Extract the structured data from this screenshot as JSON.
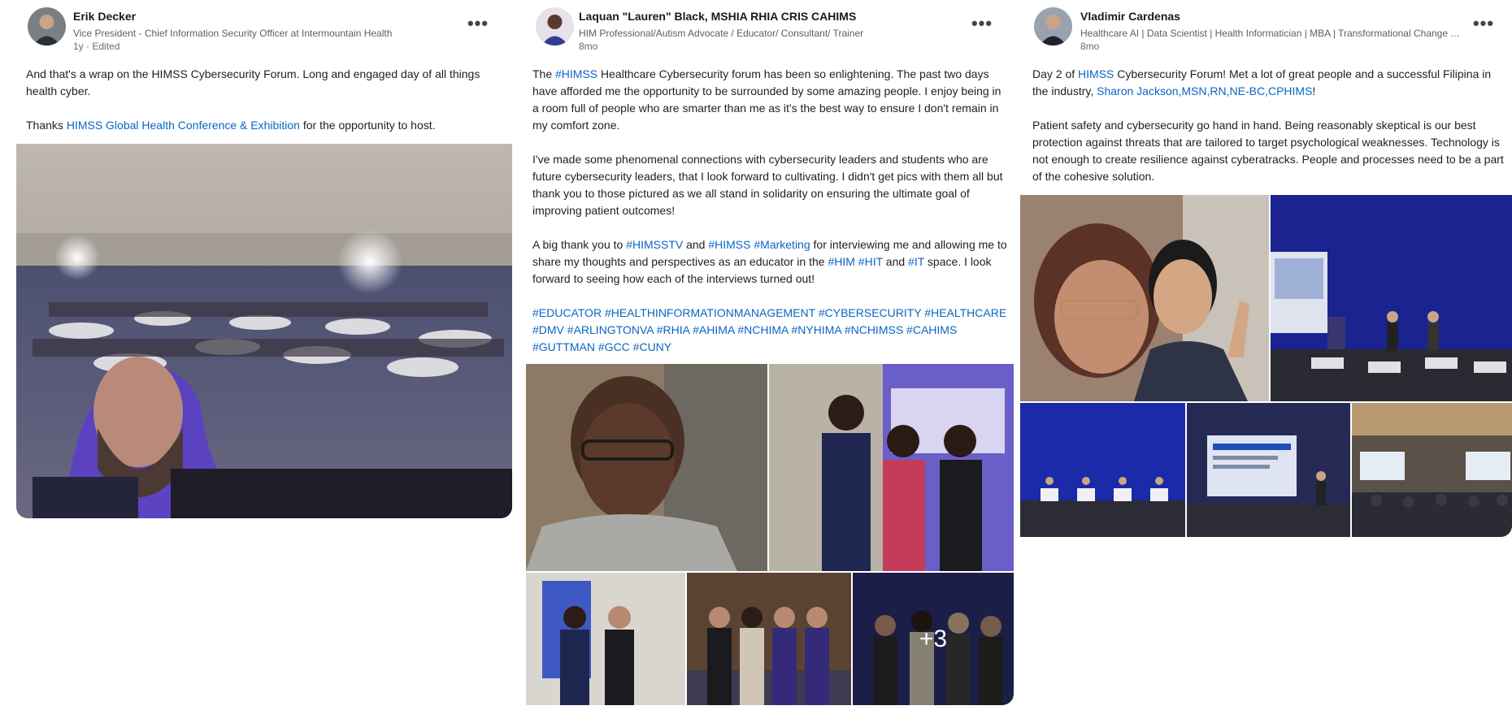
{
  "posts": [
    {
      "author": "Erik Decker",
      "headline": "Vice President - Chief Information Security Officer at Intermountain Health",
      "time": "1y",
      "edited": "Edited",
      "more_label": "•••",
      "text1": "And that's a wrap on the HIMSS Cybersecurity Forum. Long and engaged day of all things health cyber.",
      "text2_pre": "Thanks ",
      "text2_link": "HIMSS Global Health Conference & Exhibition",
      "text2_post": "  for the opportunity to host.",
      "image_icon": "conference-hall-selfie-photo"
    },
    {
      "author": "Laquan \"Lauren\" Black, MSHIA RHIA CRIS CAHIMS",
      "headline": "HIM Professional/Autism Advocate / Educator/ Consultant/ Trainer",
      "time": "8mo",
      "more_label": "•••",
      "para1_pre": "The ",
      "para1_tag": "#HIMSS",
      "para1_post": " Healthcare Cybersecurity forum has been so enlightening. The past two days have afforded me the opportunity to be surrounded by some amazing people. I enjoy being in a room full of people who are smarter than me as it's the best way to ensure I don't remain in my comfort zone.",
      "para2": "I've made some phenomenal connections with cybersecurity leaders and students who are future cybersecurity leaders, that I look forward to cultivating. I didn't get pics with them all but thank you to those pictured as we all stand in solidarity on ensuring the ultimate goal of improving patient outcomes!",
      "para3_a": "A big thank you to ",
      "para3_tag1": "#HIMSSTV",
      "para3_b": " and ",
      "para3_tag2": "#HIMSS #Marketing",
      "para3_c": " for interviewing me and allowing me to share my thoughts and perspectives as an educator in the ",
      "para3_tag3": "#HIM #HIT",
      "para3_d": " and ",
      "para3_tag4": "#IT",
      "para3_e": " space. I look forward to seeing how each of the interviews turned out!",
      "hashtags": "#EDUCATOR #HEALTHINFORMATIONMANAGEMENT #CYBERSECURITY #HEALTHCARE #DMV #ARLINGTONVA #RHIA #AHIMA #NCHIMA #NYHIMA #NCHIMSS #CAHIMS #GUTTMAN #GCC #CUNY",
      "plus_more": "+3"
    },
    {
      "author": "Vladimir Cardenas",
      "headline": "Healthcare AI | Data Scientist | Health Informatician | MBA | Transformational Change A...",
      "time": "8mo",
      "more_label": "•••",
      "para1_a": "Day 2 of ",
      "para1_tag": "HIMSS",
      "para1_b": " Cybersecurity Forum! Met a lot of great people and a successful Filipina in the industry, ",
      "para1_mention": "Sharon Jackson,MSN,RN,NE-BC,CPHIMS",
      "para1_c": "!",
      "para2": "Patient safety and cybersecurity go hand in hand. Being reasonably skeptical is our best protection against threats that are tailored to target psychological weaknesses. Technology is not enough to create resilience against cyberatracks. People and processes need to be a part of the cohesive solution."
    }
  ]
}
